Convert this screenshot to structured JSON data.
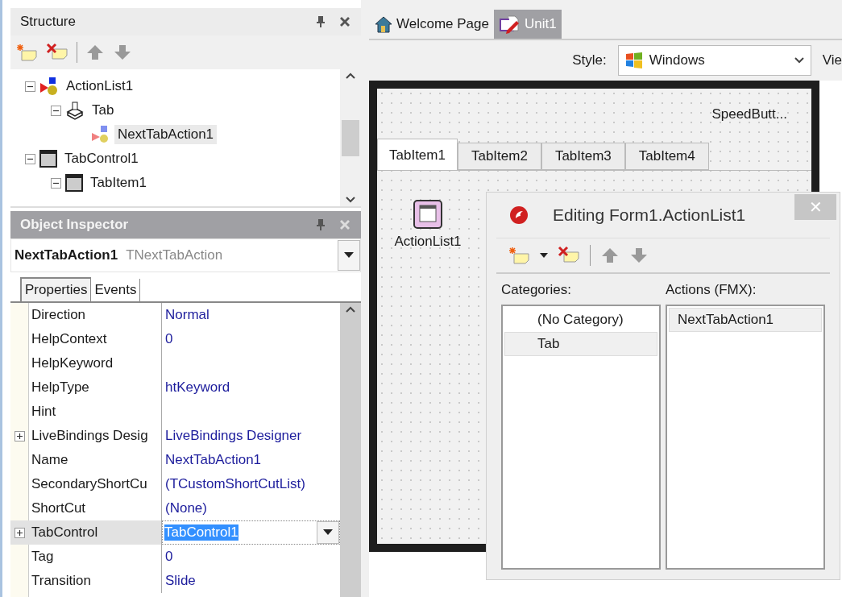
{
  "structure": {
    "title": "Structure",
    "tree": [
      {
        "label": "ActionList1",
        "kind": "actionlist",
        "expanded": true,
        "selected": false,
        "children": [
          {
            "label": "Tab",
            "kind": "category",
            "expanded": true,
            "selected": false,
            "children": [
              {
                "label": "NextTabAction1",
                "kind": "action",
                "selected": true
              }
            ]
          }
        ]
      },
      {
        "label": "TabControl1",
        "kind": "window",
        "expanded": true,
        "selected": false,
        "children": [
          {
            "label": "TabItem1",
            "kind": "window",
            "expanded": true,
            "selected": false
          }
        ]
      }
    ]
  },
  "inspector": {
    "title": "Object Inspector",
    "object_name": "NextTabAction1",
    "object_type": "TNextTabAction",
    "tabs": [
      {
        "label": "Properties",
        "selected": true
      },
      {
        "label": "Events",
        "selected": false
      }
    ],
    "properties": [
      {
        "name": "Direction",
        "value": "Normal",
        "expandable": false,
        "selected": false
      },
      {
        "name": "HelpContext",
        "value": "0",
        "expandable": false,
        "selected": false
      },
      {
        "name": "HelpKeyword",
        "expandable": false,
        "selected": false
      },
      {
        "name": "HelpType",
        "value": "htKeyword",
        "expandable": false,
        "selected": false
      },
      {
        "name": "Hint",
        "expandable": false,
        "selected": false
      },
      {
        "name": "LiveBindings Desig",
        "value": "LiveBindings Designer",
        "expandable": true,
        "selected": false
      },
      {
        "name": "Name",
        "value": "NextTabAction1",
        "expandable": false,
        "selected": false
      },
      {
        "name": "SecondaryShortCu",
        "value": "(TCustomShortCutList)",
        "expandable": false,
        "selected": false
      },
      {
        "name": "ShortCut",
        "value": "(None)",
        "expandable": false,
        "selected": false
      },
      {
        "name": "TabControl",
        "value": "TabControl1",
        "expandable": true,
        "selected": true
      },
      {
        "name": "Tag",
        "value": "0",
        "expandable": false,
        "selected": false
      },
      {
        "name": "Transition",
        "value": "Slide",
        "expandable": false,
        "selected": false
      }
    ]
  },
  "editor_tabs": [
    {
      "label": "Welcome Page",
      "kind": "welcome",
      "selected": false
    },
    {
      "label": "Unit1",
      "kind": "unit",
      "selected": true
    }
  ],
  "designer_toolbar": {
    "style_label": "Style:",
    "style_value": "Windows",
    "view_label": "Vie"
  },
  "form": {
    "speed_button": "SpeedButt...",
    "tabs": [
      {
        "label": "TabItem1",
        "selected": true
      },
      {
        "label": "TabItem2",
        "selected": false
      },
      {
        "label": "TabItem3",
        "selected": false
      },
      {
        "label": "TabItem4",
        "selected": false
      }
    ],
    "component": "ActionList1"
  },
  "dialog": {
    "title": "Editing Form1.ActionList1",
    "close": "✕",
    "categories_label": "Categories:",
    "actions_label": "Actions (FMX):",
    "categories": [
      {
        "label": "(No Category)",
        "selected": false
      },
      {
        "label": "Tab",
        "selected": true
      }
    ],
    "actions": [
      {
        "label": "NextTabAction1",
        "selected": true
      }
    ]
  }
}
